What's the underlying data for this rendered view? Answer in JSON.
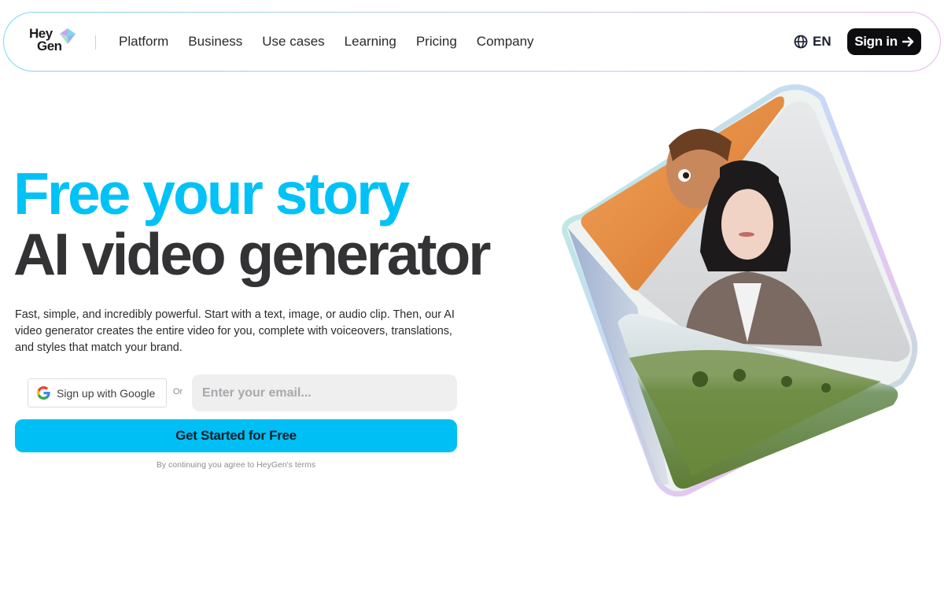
{
  "nav": {
    "logo_line1": "Hey",
    "logo_line2": "Gen",
    "menu": [
      {
        "label": "Platform"
      },
      {
        "label": "Business"
      },
      {
        "label": "Use cases"
      },
      {
        "label": "Learning"
      },
      {
        "label": "Pricing"
      },
      {
        "label": "Company"
      }
    ],
    "language_label": "EN",
    "signin_label": "Sign in",
    "icons": {
      "language": "globe-icon",
      "signin": "arrow-right-icon"
    }
  },
  "hero": {
    "headline_blue": "Free your story",
    "headline_dark": "AI video generator",
    "description": "Fast, simple, and incredibly powerful. Start with a text, image, or audio clip. Then, our AI video generator creates the entire video for you, complete with voiceovers, translations, and styles that match your brand.",
    "google_button_label": "Sign up with Google",
    "or_label": "Or",
    "email_placeholder": "Enter your email...",
    "email_value": "",
    "cta_label": "Get Started for Free",
    "terms_text": "By continuing you agree to HeyGen's terms"
  },
  "colors": {
    "accent_blue": "#00c2f7",
    "cta_blue": "#00bff5",
    "headline_dark": "#333335",
    "signin_bg": "#0d0d0f"
  }
}
